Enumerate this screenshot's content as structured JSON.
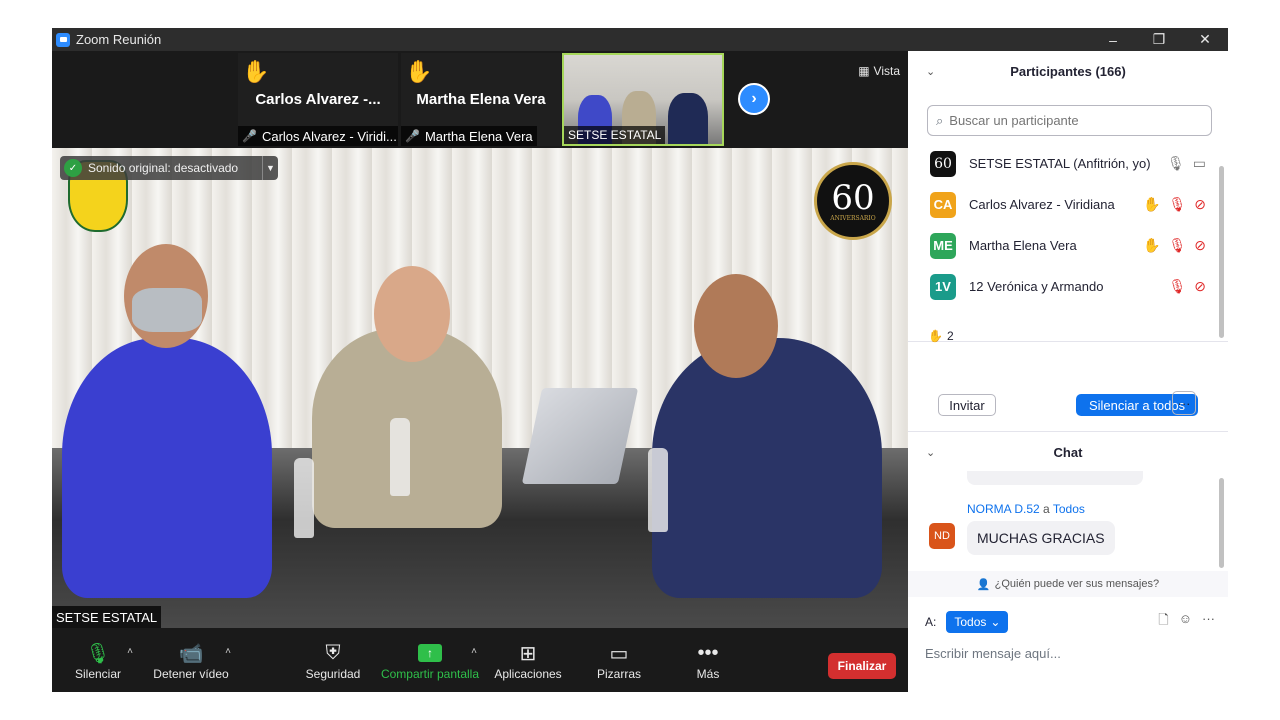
{
  "window": {
    "title": "Zoom Reunión",
    "controls": {
      "minimize": "–",
      "restore": "❐",
      "close": "✕"
    }
  },
  "strip": {
    "tiles": [
      {
        "display_name": "Carlos Alvarez -...",
        "tag": "Carlos Alvarez - Viridi...",
        "hand": "✋",
        "muted": true
      },
      {
        "display_name": "Martha Elena Vera",
        "tag": "Martha Elena Vera",
        "hand": "✋",
        "muted": true
      },
      {
        "tag": "SETSE ESTATAL"
      }
    ],
    "next_icon": "chevron-right-icon",
    "view_label": "Vista"
  },
  "main_video": {
    "sound_label": "Sonido original: desactivado",
    "logo_number": "60",
    "logo_text": "ANIVERSARIO",
    "name_tag": "SETSE ESTATAL"
  },
  "toolbar": {
    "mute": "Silenciar",
    "video": "Detener vídeo",
    "security": "Seguridad",
    "share": "Compartir pantalla",
    "apps": "Aplicaciones",
    "whiteboards": "Pizarras",
    "more": "Más",
    "end": "Finalizar",
    "colors": {
      "share": "#2fbf4a",
      "end": "#d32f2f"
    }
  },
  "participants": {
    "header": "Participantes (166)",
    "search_placeholder": "Buscar un participante",
    "list": [
      {
        "avatar": "60",
        "name": "SETSE ESTATAL (Anfitrión, yo)",
        "avatar_color": "#111111",
        "hand": false,
        "mic": "on",
        "video": "on"
      },
      {
        "avatar": "CA",
        "name": "Carlos Alvarez - Viridiana",
        "avatar_color": "#f0a31a",
        "hand": true,
        "mic": "off",
        "video": "off"
      },
      {
        "avatar": "ME",
        "name": "Martha Elena Vera",
        "avatar_color": "#2ea65a",
        "hand": true,
        "mic": "off",
        "video": "off"
      },
      {
        "avatar": "1V",
        "name": "12 Verónica y Armando",
        "avatar_color": "#1a9b8a",
        "hand": false,
        "mic": "off",
        "video": "off"
      }
    ],
    "raised_hands": "2",
    "invite": "Invitar",
    "mute_all": "Silenciar a todos",
    "more": "···"
  },
  "chat": {
    "header": "Chat",
    "sender": "NORMA D.52",
    "to_word": "a",
    "recipient": "Todos",
    "avatar": "ND",
    "avatar_color": "#d9541a",
    "message": "MUCHAS GRACIAS",
    "who_can_see": "¿Quién puede ver sus mensajes?",
    "to_label": "A:",
    "to_value": "Todos",
    "input_placeholder": "Escribir mensaje aquí..."
  }
}
